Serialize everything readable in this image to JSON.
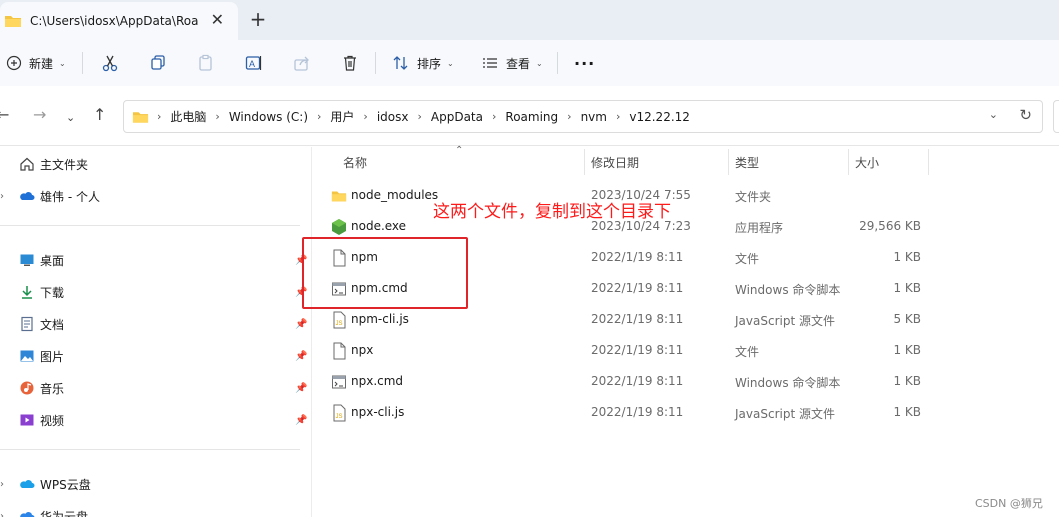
{
  "window": {
    "tab_title": "C:\\Users\\idosx\\AppData\\Roar",
    "close_glyph": "✕",
    "newtab_glyph": "+"
  },
  "toolbar": {
    "new_label": "新建",
    "sort_label": "排序",
    "view_label": "查看",
    "more_glyph": "···",
    "icons": [
      "plus-circle-icon",
      "cut-icon",
      "copy-icon",
      "paste-icon",
      "rename-icon",
      "share-icon",
      "delete-icon",
      "sort-icon",
      "view-icon"
    ]
  },
  "addressbar": {
    "crumbs": [
      "此电脑",
      "Windows (C:)",
      "用户",
      "idosx",
      "AppData",
      "Roaming",
      "nvm",
      "v12.22.12"
    ]
  },
  "sidebar": {
    "items": [
      {
        "label": "主文件夹",
        "icon": "home-icon"
      },
      {
        "label": "雄伟 - 个人",
        "icon": "onedrive-icon"
      },
      {
        "label": "桌面",
        "icon": "desktop-icon"
      },
      {
        "label": "下载",
        "icon": "download-icon"
      },
      {
        "label": "文档",
        "icon": "documents-icon"
      },
      {
        "label": "图片",
        "icon": "pictures-icon"
      },
      {
        "label": "音乐",
        "icon": "music-icon"
      },
      {
        "label": "视频",
        "icon": "videos-icon"
      },
      {
        "label": "WPS云盘",
        "icon": "wps-cloud-icon"
      },
      {
        "label": "华为云盘",
        "icon": "huawei-cloud-icon"
      }
    ]
  },
  "columns": {
    "name": "名称",
    "date": "修改日期",
    "type": "类型",
    "size": "大小"
  },
  "files": [
    {
      "name": "node_modules",
      "date": "2023/10/24 7:55",
      "type": "文件夹",
      "size": "",
      "icon": "folder-icon"
    },
    {
      "name": "node.exe",
      "date": "2023/10/24 7:23",
      "type": "应用程序",
      "size": "29,566 KB",
      "icon": "nodejs-icon"
    },
    {
      "name": "npm",
      "date": "2022/1/19 8:11",
      "type": "文件",
      "size": "1 KB",
      "icon": "file-icon"
    },
    {
      "name": "npm.cmd",
      "date": "2022/1/19 8:11",
      "type": "Windows 命令脚本",
      "size": "1 KB",
      "icon": "cmd-script-icon"
    },
    {
      "name": "npm-cli.js",
      "date": "2022/1/19 8:11",
      "type": "JavaScript 源文件",
      "size": "5 KB",
      "icon": "js-file-icon"
    },
    {
      "name": "npx",
      "date": "2022/1/19 8:11",
      "type": "文件",
      "size": "1 KB",
      "icon": "file-icon"
    },
    {
      "name": "npx.cmd",
      "date": "2022/1/19 8:11",
      "type": "Windows 命令脚本",
      "size": "1 KB",
      "icon": "cmd-script-icon"
    },
    {
      "name": "npx-cli.js",
      "date": "2022/1/19 8:11",
      "type": "JavaScript 源文件",
      "size": "1 KB",
      "icon": "js-file-icon"
    }
  ],
  "annotation": {
    "text": "这两个文件，复制到这个目录下",
    "color": "#ff1a1a"
  },
  "watermark": "CSDN @狮兄"
}
